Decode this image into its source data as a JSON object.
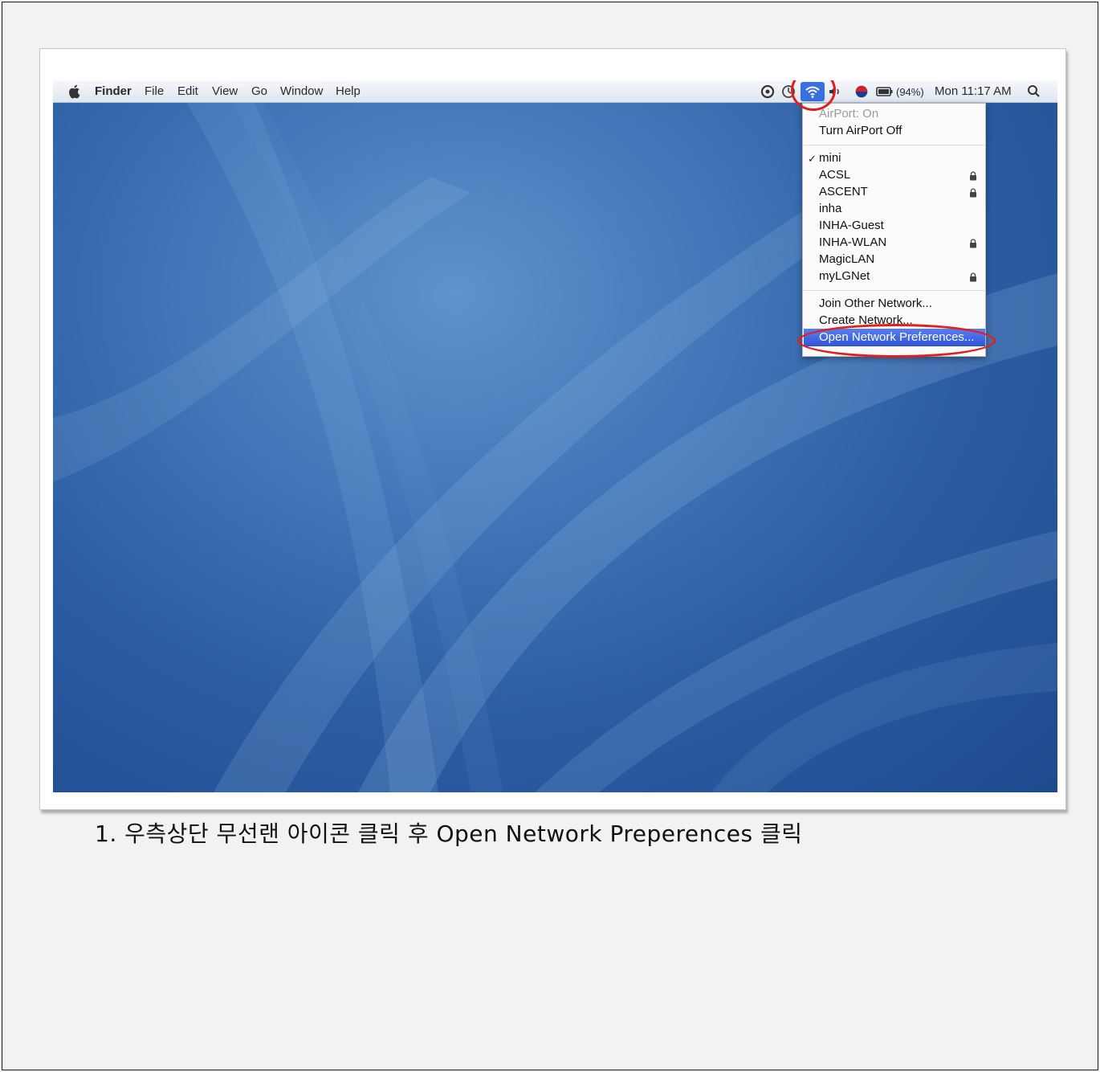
{
  "menubar": {
    "app_name": "Finder",
    "menus": [
      "File",
      "Edit",
      "View",
      "Go",
      "Window",
      "Help"
    ],
    "battery": "(94%)",
    "clock": "Mon 11:17 AM"
  },
  "airport_menu": {
    "status": "AirPort: On",
    "toggle": "Turn AirPort Off",
    "networks": [
      {
        "name": "mini",
        "checked": true,
        "locked": false
      },
      {
        "name": "ACSL",
        "checked": false,
        "locked": true
      },
      {
        "name": "ASCENT",
        "checked": false,
        "locked": true
      },
      {
        "name": "inha",
        "checked": false,
        "locked": false
      },
      {
        "name": "INHA-Guest",
        "checked": false,
        "locked": false
      },
      {
        "name": "INHA-WLAN",
        "checked": false,
        "locked": true
      },
      {
        "name": "MagicLAN",
        "checked": false,
        "locked": false
      },
      {
        "name": "myLGNet",
        "checked": false,
        "locked": true
      }
    ],
    "join_other": "Join Other Network...",
    "create_network": "Create Network...",
    "open_prefs": "Open Network Preferences..."
  },
  "caption": "1. 우측상단 무선랜 아이콘 클릭 후 Open Network Preperences 클릭",
  "colors": {
    "annotation_red": "#e0201c",
    "menu_highlight": "#3a5fe0",
    "wallpaper_blue": "#2c5da3"
  },
  "icons": [
    "apple-icon",
    "status-circle-icon",
    "time-machine-icon",
    "wifi-icon",
    "volume-icon",
    "flag-icon",
    "battery-icon",
    "spotlight-search-icon",
    "lock-icon",
    "checkmark-icon"
  ]
}
